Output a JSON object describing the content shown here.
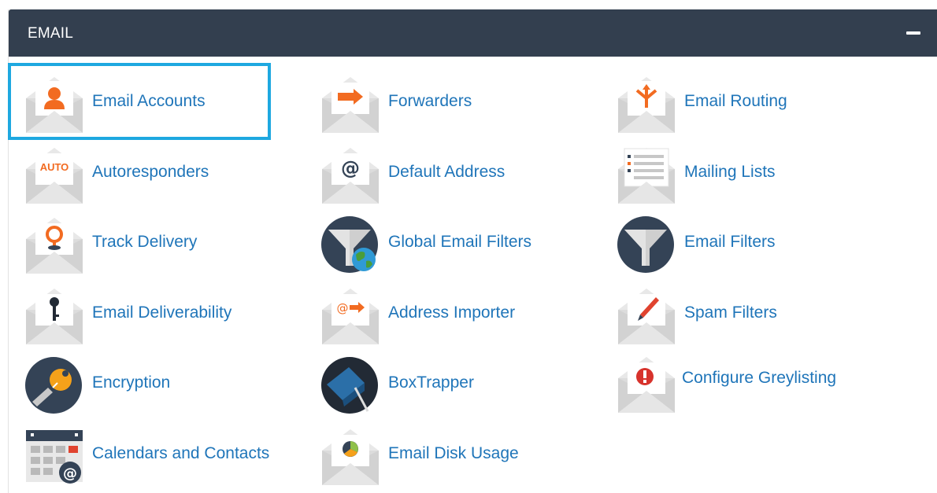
{
  "panel": {
    "title": "EMAIL",
    "collapse_icon": "minus-icon"
  },
  "items": [
    {
      "label": "Email Accounts",
      "icon": "email-accounts-icon"
    },
    {
      "label": "Forwarders",
      "icon": "forwarders-icon"
    },
    {
      "label": "Email Routing",
      "icon": "email-routing-icon"
    },
    {
      "label": "Autoresponders",
      "icon": "autoresponders-icon"
    },
    {
      "label": "Default Address",
      "icon": "default-address-icon"
    },
    {
      "label": "Mailing Lists",
      "icon": "mailing-lists-icon"
    },
    {
      "label": "Track Delivery",
      "icon": "track-delivery-icon"
    },
    {
      "label": "Global Email Filters",
      "icon": "global-email-filters-icon"
    },
    {
      "label": "Email Filters",
      "icon": "email-filters-icon"
    },
    {
      "label": "Email Deliverability",
      "icon": "email-deliverability-icon"
    },
    {
      "label": "Address Importer",
      "icon": "address-importer-icon"
    },
    {
      "label": "Spam Filters",
      "icon": "spam-filters-icon"
    },
    {
      "label": "Encryption",
      "icon": "encryption-icon"
    },
    {
      "label": "BoxTrapper",
      "icon": "boxtrapper-icon"
    },
    {
      "label": "Configure Greylisting",
      "icon": "configure-greylisting-icon"
    },
    {
      "label": "Calendars and Contacts",
      "icon": "calendars-and-contacts-icon"
    },
    {
      "label": "Email Disk Usage",
      "icon": "email-disk-usage-icon"
    }
  ],
  "icon_text": {
    "auto": "AUTO",
    "at": "@"
  },
  "colors": {
    "header": "#333f4f",
    "link": "#1f75b9",
    "accent_orange": "#f26b21",
    "highlight": "#1ea8e0"
  }
}
